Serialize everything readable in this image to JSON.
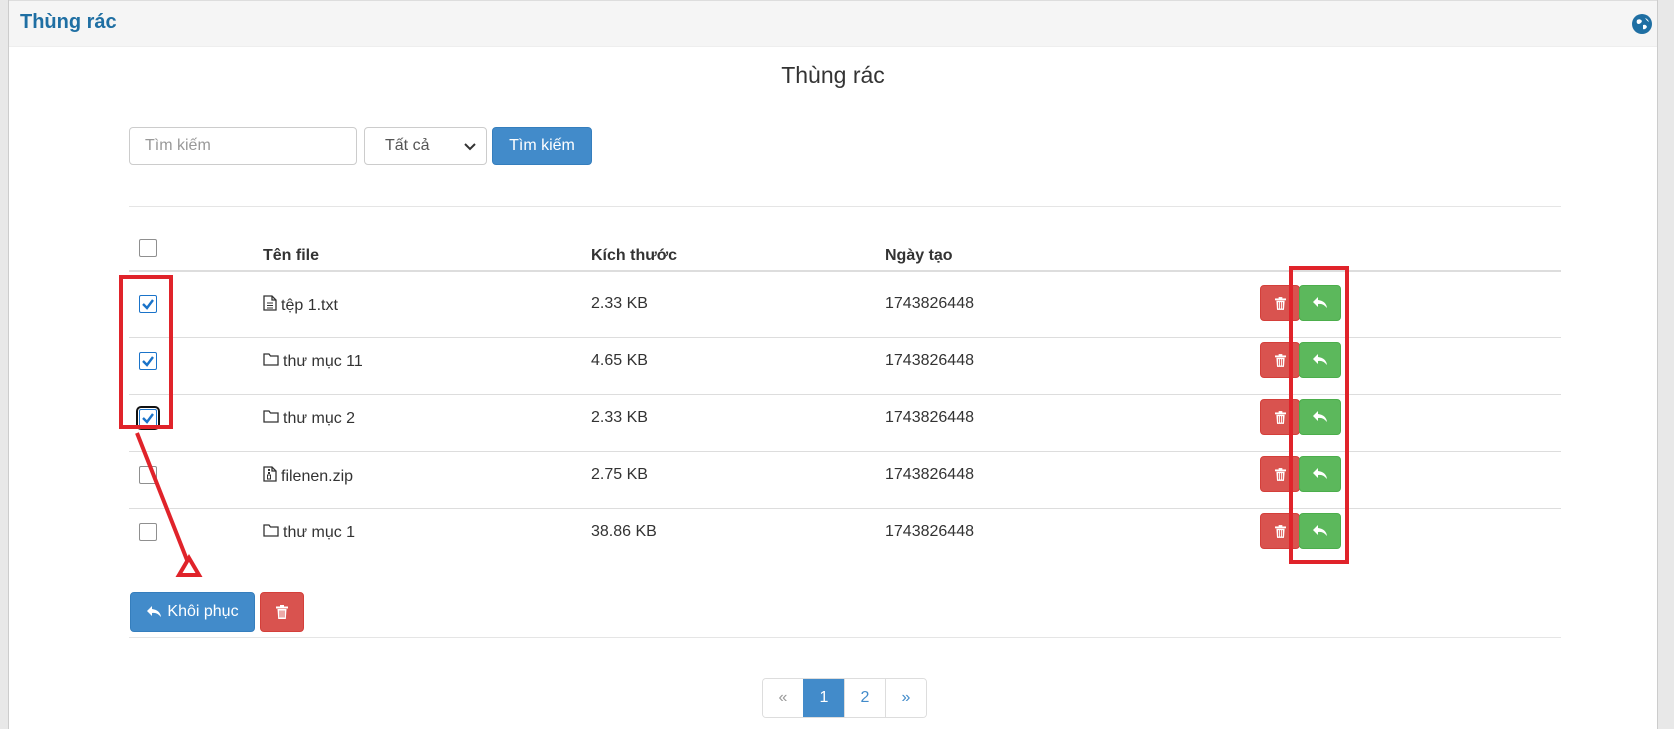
{
  "header": {
    "title": "Thùng rác",
    "globe_icon": "globe-icon"
  },
  "page": {
    "title": "Thùng rác"
  },
  "search": {
    "placeholder": "Tìm kiếm",
    "filter_value": "Tất cả",
    "button_label": "Tìm kiếm"
  },
  "table": {
    "columns": {
      "name": "Tên file",
      "size": "Kích thước",
      "created": "Ngày tạo"
    },
    "rows": [
      {
        "icon": "text-file-icon",
        "name": "tệp 1.txt",
        "size": "2.33 KB",
        "created": "1743826448",
        "checked": true
      },
      {
        "icon": "folder-icon",
        "name": "thư mục 11",
        "size": "4.65 KB",
        "created": "1743826448",
        "checked": true
      },
      {
        "icon": "folder-icon",
        "name": "thư mục 2",
        "size": "2.33 KB",
        "created": "1743826448",
        "checked": true
      },
      {
        "icon": "zip-file-icon",
        "name": "filenen.zip",
        "size": "2.75 KB",
        "created": "1743826448",
        "checked": false
      },
      {
        "icon": "folder-icon",
        "name": "thư mục 1",
        "size": "38.86 KB",
        "created": "1743826448",
        "checked": false
      }
    ]
  },
  "actions": {
    "restore_label": "Khôi phục"
  },
  "pagination": {
    "prev": "«",
    "pages": [
      "1",
      "2"
    ],
    "active": "1",
    "next": "»"
  },
  "colors": {
    "primary": "#428bca",
    "danger": "#d9534f",
    "success": "#5cb85c",
    "annotation": "#e0232a",
    "title": "#1f6fa3"
  }
}
